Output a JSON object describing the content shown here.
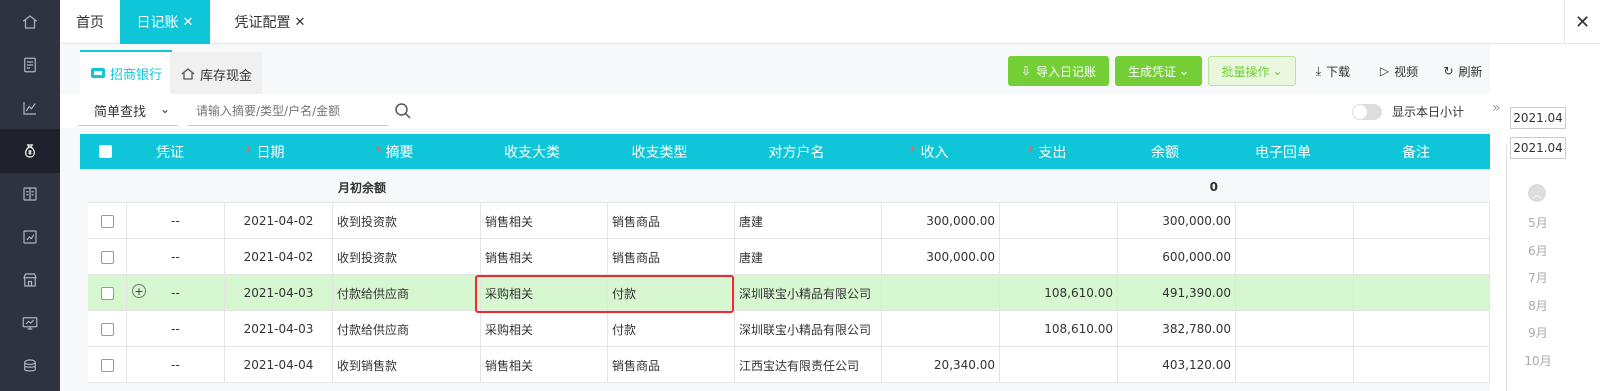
{
  "rail_icons": [
    "home-icon",
    "invoice-icon",
    "chart-icon",
    "money-bag-icon",
    "ledger-icon",
    "report-icon",
    "shop-icon",
    "monitor-icon",
    "coins-icon"
  ],
  "top_tabs": [
    {
      "label": "首页",
      "closable": false,
      "active": false
    },
    {
      "label": "日记账",
      "closable": true,
      "active": true
    },
    {
      "label": "凭证配置",
      "closable": true,
      "active": false
    }
  ],
  "close_all_label": "✕",
  "account_tabs": [
    {
      "label": "招商银行",
      "active": true
    },
    {
      "label": "库存现金",
      "active": false
    }
  ],
  "toolbar": {
    "import_label": "导入日记账",
    "generate_label": "生成凭证",
    "batch_label": "批量操作",
    "download_label": "下载",
    "video_label": "视频",
    "refresh_label": "刷新"
  },
  "search": {
    "mode": "简单查找",
    "placeholder": "请输入摘要/类型/户名/金额",
    "daily_subtotal_label": "显示本日小计",
    "daily_subtotal_on": false
  },
  "table": {
    "headers": [
      {
        "label": "凭证",
        "required": false
      },
      {
        "label": "日期",
        "required": true
      },
      {
        "label": "摘要",
        "required": true
      },
      {
        "label": "收支大类",
        "required": false
      },
      {
        "label": "收支类型",
        "required": false
      },
      {
        "label": "对方户名",
        "required": false
      },
      {
        "label": "收入",
        "required": true
      },
      {
        "label": "支出",
        "required": true
      },
      {
        "label": "余额",
        "required": false
      },
      {
        "label": "电子回单",
        "required": false
      },
      {
        "label": "备注",
        "required": false
      }
    ],
    "opening_label": "月初余额",
    "opening_balance": "0",
    "rows": [
      {
        "voucher": "--",
        "date": "2021-04-02",
        "summary": "收到投资款",
        "category": "销售相关",
        "type": "销售商品",
        "party": "唐建",
        "income": "300,000.00",
        "expense": "",
        "balance": "300,000.00",
        "receipt": "",
        "note": "",
        "highlight": false
      },
      {
        "voucher": "--",
        "date": "2021-04-02",
        "summary": "收到投资款",
        "category": "销售相关",
        "type": "销售商品",
        "party": "唐建",
        "income": "300,000.00",
        "expense": "",
        "balance": "600,000.00",
        "receipt": "",
        "note": "",
        "highlight": false
      },
      {
        "voucher": "--",
        "date": "2021-04-03",
        "summary": "付款给供应商",
        "category": "采购相关",
        "type": "付款",
        "party": "深圳联宝小精品有限公司",
        "income": "",
        "expense": "108,610.00",
        "balance": "491,390.00",
        "receipt": "",
        "note": "",
        "highlight": true
      },
      {
        "voucher": "--",
        "date": "2021-04-03",
        "summary": "付款给供应商",
        "category": "采购相关",
        "type": "付款",
        "party": "深圳联宝小精品有限公司",
        "income": "",
        "expense": "108,610.00",
        "balance": "382,780.00",
        "receipt": "",
        "note": "",
        "highlight": false
      },
      {
        "voucher": "--",
        "date": "2021-04-04",
        "summary": "收到销售款",
        "category": "销售相关",
        "type": "销售商品",
        "party": "江西宝达有限责任公司",
        "income": "20,340.00",
        "expense": "",
        "balance": "403,120.00",
        "receipt": "",
        "note": "",
        "highlight": false
      }
    ]
  },
  "month_panel": {
    "date_from": "2021.04",
    "date_to": "2021.04",
    "months": [
      "5月",
      "6月",
      "7月",
      "8月",
      "9月",
      "10月"
    ]
  },
  "colors": {
    "accent": "#0fc6d8",
    "green": "#74cf36",
    "highlight_row": "#d6f7d0",
    "annotation": "#f02b2b",
    "rail": "#2f3340"
  }
}
